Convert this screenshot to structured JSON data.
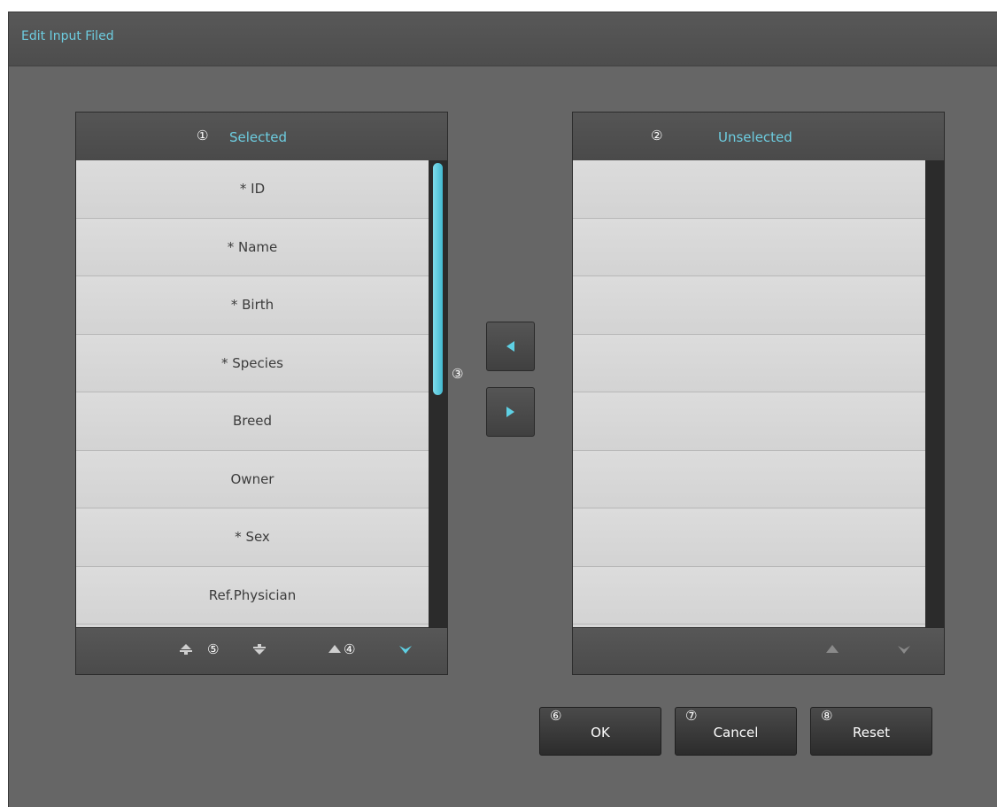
{
  "dialog": {
    "title": "Edit Input Filed"
  },
  "selected_panel": {
    "marker": "①",
    "title": "Selected",
    "items": [
      "* ID",
      "* Name",
      "* Birth",
      "* Species",
      "Breed",
      "Owner",
      "* Sex",
      "Ref.Physician"
    ],
    "footer": {
      "move_top_icon": "move-to-top-icon",
      "marker_5": "⑤",
      "move_bottom_icon": "move-to-bottom-icon",
      "move_up_icon": "chevron-up-icon",
      "marker_4": "④",
      "move_down_icon": "chevron-down-icon"
    }
  },
  "unselected_panel": {
    "marker": "②",
    "title": "Unselected",
    "items": [
      "",
      "",
      "",
      "",
      "",
      "",
      "",
      ""
    ],
    "footer": {
      "move_up_icon": "chevron-up-icon",
      "move_down_icon": "chevron-down-icon"
    }
  },
  "transfer": {
    "marker": "③",
    "to_selected_icon": "arrow-left-icon",
    "to_unselected_icon": "arrow-right-icon"
  },
  "buttons": {
    "ok": {
      "marker": "⑥",
      "label": "OK"
    },
    "cancel": {
      "marker": "⑦",
      "label": "Cancel"
    },
    "reset": {
      "marker": "⑧",
      "label": "Reset"
    }
  },
  "colors": {
    "accent": "#6dcde0",
    "background": "#666666",
    "list_row": "#d7d7d7",
    "scroll_thumb": "#43b9d0"
  }
}
